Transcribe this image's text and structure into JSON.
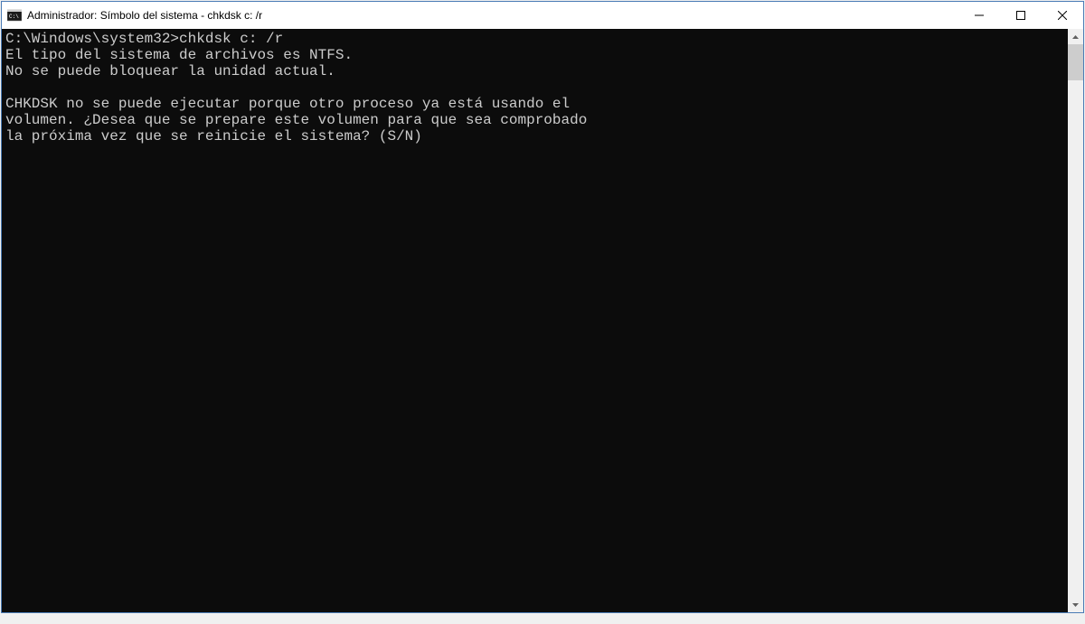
{
  "window": {
    "title": "Administrador: Símbolo del sistema - chkdsk  c: /r"
  },
  "terminal": {
    "prompt": "C:\\Windows\\system32>",
    "command": "chkdsk c: /r",
    "output": {
      "line1": "El tipo del sistema de archivos es NTFS.",
      "line2": "No se puede bloquear la unidad actual.",
      "line3": "",
      "line4": "CHKDSK no se puede ejecutar porque otro proceso ya está usando el",
      "line5": "volumen. ¿Desea que se prepare este volumen para que sea comprobado",
      "line6": "la próxima vez que se reinicie el sistema? (S/N)"
    }
  }
}
